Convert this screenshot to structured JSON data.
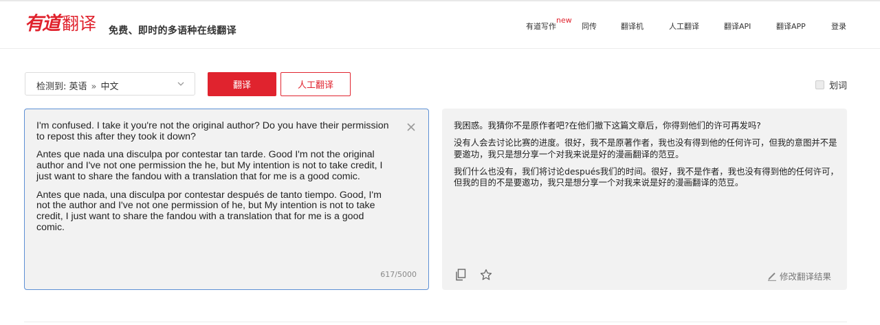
{
  "header": {
    "logo_brand": "有道",
    "logo_product": "翻译",
    "slogan": "免费、即时的多语种在线翻译",
    "nav": [
      {
        "label": "有道写作",
        "badge": "new"
      },
      {
        "label": "同传"
      },
      {
        "label": "翻译机"
      },
      {
        "label": "人工翻译"
      },
      {
        "label": "翻译API"
      },
      {
        "label": "翻译APP"
      },
      {
        "label": "登录"
      }
    ]
  },
  "toolbar": {
    "lang_detected_label": "检测到:",
    "source_lang": "英语",
    "arrow": "»",
    "target_lang": "中文",
    "translate_button": "翻译",
    "human_translate_button": "人工翻译",
    "word_pick_label": "划词",
    "word_pick_checked": false
  },
  "source": {
    "paragraphs": [
      "I'm confused. I take it you're not the original author? Do you have their permission to repost this after they took it down?",
      "Antes que nada una disculpa por contestar tan tarde. Good I'm not the original author and I've not one permission the he, but My intention is not to take credit, I just want to share the fandou with a translation that for me is a good comic.",
      "Antes que nada, una disculpa por contestar después de tanto tiempo. Good, I'm not the author and I've not one permission of he, but My intention is not to take credit, I just want to share the fandou with a translation that for me is a good comic."
    ],
    "char_count": "617/5000"
  },
  "result": {
    "paragraphs": [
      "我困惑。我猜你不是原作者吧?在他们撤下这篇文章后，你得到他们的许可再发吗?",
      "没有人会去讨论比赛的进度。很好，我不是原著作者，我也没有得到他的任何许可，但我的意图并不是要邀功，我只是想分享一个对我来说是好的漫画翻译的范豆。",
      "我们什么也没有，我们将讨论después我们的时间。很好，我不是作者，我也没有得到他的任何许可，但我的目的不是要邀功，我只是想分享一个对我来说是好的漫画翻译的范豆。"
    ],
    "edit_label": "修改翻译结果"
  },
  "colors": {
    "brand_red": "#e0232e",
    "focus_border": "#5b8ed4",
    "panel_bg": "#f2f2f2"
  }
}
